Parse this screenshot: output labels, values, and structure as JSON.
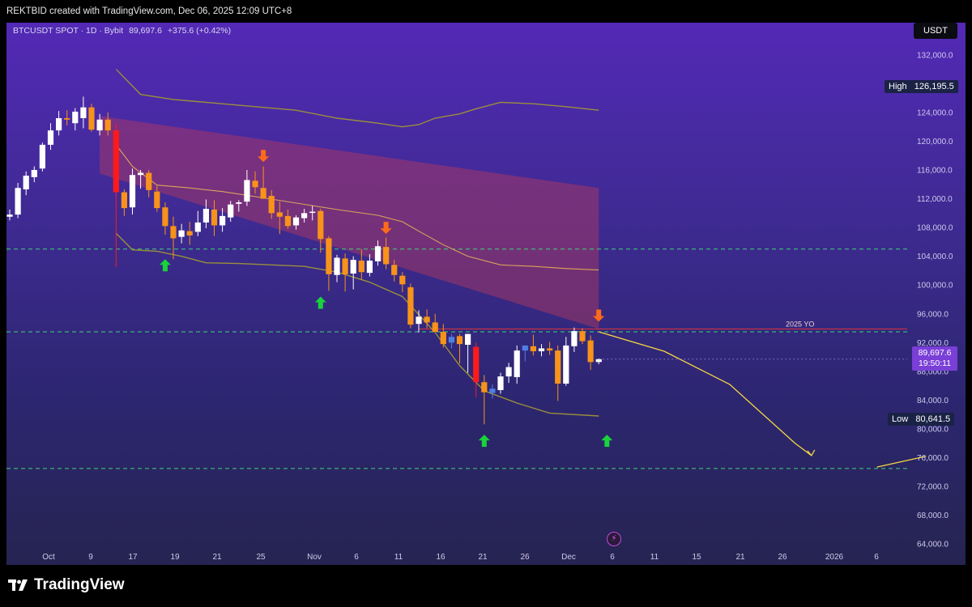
{
  "header": {
    "credit": "REKTBID created with TradingView.com, Dec 06, 2025 12:09 UTC+8"
  },
  "legend": {
    "symbol": "BTCUSDT SPOT · 1D · Bybit",
    "last": "89,697.6",
    "change": "+375.6 (+0.42%)"
  },
  "axis": {
    "currency": "USDT",
    "y_ticks": [
      "132,000.0",
      "128,000.0",
      "124,000.0",
      "120,000.0",
      "116,000.0",
      "112,000.0",
      "108,000.0",
      "104,000.0",
      "100,000.0",
      "96,000.0",
      "92,000.0",
      "88,000.0",
      "84,000.0",
      "80,000.0",
      "76,000.0",
      "72,000.0",
      "68,000.0",
      "64,000.0"
    ],
    "x_ticks": [
      "Oct",
      "9",
      "17",
      "19",
      "21",
      "25",
      "Nov",
      "6",
      "11",
      "16",
      "21",
      "26",
      "Dec",
      "6",
      "11",
      "15",
      "21",
      "26",
      "2026",
      "6"
    ]
  },
  "markers": {
    "high_label": "High",
    "high_value": "126,195.5",
    "low_label": "Low",
    "low_value": "80,641.5",
    "price_value": "89,697.6",
    "countdown": "19:50:11",
    "yo_label": "2025 YO"
  },
  "brand": {
    "name": "TradingView"
  },
  "colors": {
    "up": "#ffffff",
    "down": "#f7931a",
    "highlight_down": "#ff1a1a",
    "highlight_up": "#4f7fe0",
    "band": "#9a8f3a",
    "mid_band": "#d9a45a",
    "zone": "#b93a5e",
    "level": "#3fd47a",
    "yo_line": "#e0303a",
    "projection": "#f5d742",
    "arrow_up": "#19d33a",
    "arrow_down": "#ff6a1a"
  },
  "chart_data": {
    "type": "candlestick",
    "symbol": "BTCUSDT",
    "interval": "1D",
    "ylim": [
      62000,
      134000
    ],
    "horizontal_levels": [
      105000,
      93500,
      74500
    ],
    "yo_level": 93900,
    "candles": [
      {
        "o": 109500,
        "h": 110500,
        "l": 109000,
        "c": 109800
      },
      {
        "o": 109800,
        "h": 114200,
        "l": 109300,
        "c": 113500
      },
      {
        "o": 113300,
        "h": 115800,
        "l": 112500,
        "c": 115200
      },
      {
        "o": 115000,
        "h": 116500,
        "l": 114300,
        "c": 116000
      },
      {
        "o": 116200,
        "h": 119800,
        "l": 115800,
        "c": 119500
      },
      {
        "o": 119500,
        "h": 122500,
        "l": 118800,
        "c": 121500
      },
      {
        "o": 121500,
        "h": 124200,
        "l": 120800,
        "c": 123200
      },
      {
        "o": 123200,
        "h": 124300,
        "l": 122200,
        "c": 123000
      },
      {
        "o": 122500,
        "h": 124600,
        "l": 121500,
        "c": 124100
      },
      {
        "o": 123200,
        "h": 126195,
        "l": 121800,
        "c": 124700
      },
      {
        "o": 124700,
        "h": 125200,
        "l": 121300,
        "c": 121600
      },
      {
        "o": 121500,
        "h": 123800,
        "l": 120800,
        "c": 123000
      },
      {
        "o": 123000,
        "h": 124000,
        "l": 120800,
        "c": 121500
      },
      {
        "o": 121500,
        "h": 122500,
        "l": 102500,
        "c": 112900
      },
      {
        "o": 112900,
        "h": 113300,
        "l": 109600,
        "c": 110700
      },
      {
        "o": 110800,
        "h": 116200,
        "l": 109800,
        "c": 115300
      },
      {
        "o": 115300,
        "h": 116000,
        "l": 113400,
        "c": 115600
      },
      {
        "o": 115600,
        "h": 116000,
        "l": 112200,
        "c": 113200
      },
      {
        "o": 113000,
        "h": 113800,
        "l": 110200,
        "c": 110700
      },
      {
        "o": 110800,
        "h": 111500,
        "l": 107000,
        "c": 108200
      },
      {
        "o": 108200,
        "h": 109500,
        "l": 103600,
        "c": 106500
      },
      {
        "o": 106700,
        "h": 108500,
        "l": 105800,
        "c": 107600
      },
      {
        "o": 107500,
        "h": 108800,
        "l": 105600,
        "c": 106900
      },
      {
        "o": 107400,
        "h": 110300,
        "l": 106800,
        "c": 108700
      },
      {
        "o": 108700,
        "h": 111900,
        "l": 107900,
        "c": 110600
      },
      {
        "o": 110500,
        "h": 111800,
        "l": 106800,
        "c": 108300
      },
      {
        "o": 108300,
        "h": 110700,
        "l": 107400,
        "c": 109600
      },
      {
        "o": 109400,
        "h": 111700,
        "l": 108800,
        "c": 111200
      },
      {
        "o": 111300,
        "h": 111800,
        "l": 110200,
        "c": 111500
      },
      {
        "o": 111600,
        "h": 116000,
        "l": 111000,
        "c": 114600
      },
      {
        "o": 114500,
        "h": 115800,
        "l": 112700,
        "c": 113600
      },
      {
        "o": 113500,
        "h": 116500,
        "l": 112800,
        "c": 112000
      },
      {
        "o": 112400,
        "h": 113200,
        "l": 109200,
        "c": 110000
      },
      {
        "o": 110100,
        "h": 111600,
        "l": 107100,
        "c": 109500
      },
      {
        "o": 109600,
        "h": 110500,
        "l": 107800,
        "c": 108200
      },
      {
        "o": 108300,
        "h": 109700,
        "l": 107700,
        "c": 109400
      },
      {
        "o": 109300,
        "h": 110600,
        "l": 108700,
        "c": 110000
      },
      {
        "o": 110100,
        "h": 111000,
        "l": 109000,
        "c": 110200
      },
      {
        "o": 110300,
        "h": 110600,
        "l": 104500,
        "c": 106400
      },
      {
        "o": 106500,
        "h": 106800,
        "l": 99200,
        "c": 101500
      },
      {
        "o": 101400,
        "h": 104200,
        "l": 100400,
        "c": 103800
      },
      {
        "o": 103700,
        "h": 104400,
        "l": 99100,
        "c": 101500
      },
      {
        "o": 101600,
        "h": 104000,
        "l": 99400,
        "c": 103500
      },
      {
        "o": 103400,
        "h": 105000,
        "l": 100800,
        "c": 101800
      },
      {
        "o": 101700,
        "h": 104300,
        "l": 101200,
        "c": 103400
      },
      {
        "o": 103300,
        "h": 106200,
        "l": 102700,
        "c": 105400
      },
      {
        "o": 105300,
        "h": 106600,
        "l": 102200,
        "c": 102900
      },
      {
        "o": 102800,
        "h": 103500,
        "l": 100500,
        "c": 101400
      },
      {
        "o": 101300,
        "h": 101800,
        "l": 99000,
        "c": 100100
      },
      {
        "o": 99700,
        "h": 100200,
        "l": 94000,
        "c": 94500
      },
      {
        "o": 94600,
        "h": 96500,
        "l": 93400,
        "c": 95600
      },
      {
        "o": 95600,
        "h": 96600,
        "l": 94000,
        "c": 94800
      },
      {
        "o": 94800,
        "h": 96000,
        "l": 93800,
        "c": 93500
      },
      {
        "o": 93500,
        "h": 94600,
        "l": 91300,
        "c": 91800
      },
      {
        "o": 92000,
        "h": 93200,
        "l": 91200,
        "c": 92800
      },
      {
        "o": 92900,
        "h": 93200,
        "l": 89100,
        "c": 91800
      },
      {
        "o": 91700,
        "h": 93200,
        "l": 87800,
        "c": 93200
      },
      {
        "o": 91400,
        "h": 92000,
        "l": 84400,
        "c": 86500
      },
      {
        "o": 86500,
        "h": 87500,
        "l": 80641,
        "c": 85100
      },
      {
        "o": 85000,
        "h": 86200,
        "l": 84200,
        "c": 85600
      },
      {
        "o": 85400,
        "h": 87800,
        "l": 84900,
        "c": 87300
      },
      {
        "o": 87300,
        "h": 89200,
        "l": 86400,
        "c": 88600
      },
      {
        "o": 87200,
        "h": 91600,
        "l": 86300,
        "c": 90900
      },
      {
        "o": 90900,
        "h": 91500,
        "l": 89400,
        "c": 91600
      },
      {
        "o": 91500,
        "h": 93100,
        "l": 90200,
        "c": 90800
      },
      {
        "o": 90800,
        "h": 91800,
        "l": 90100,
        "c": 91200
      },
      {
        "o": 91200,
        "h": 92100,
        "l": 90300,
        "c": 90900
      },
      {
        "o": 90900,
        "h": 91600,
        "l": 83900,
        "c": 86300
      },
      {
        "o": 86300,
        "h": 92800,
        "l": 86000,
        "c": 91600
      },
      {
        "o": 91500,
        "h": 94100,
        "l": 90700,
        "c": 93600
      },
      {
        "o": 93600,
        "h": 94000,
        "l": 91800,
        "c": 92200
      },
      {
        "o": 92300,
        "h": 93000,
        "l": 88200,
        "c": 89300
      },
      {
        "o": 89300,
        "h": 89800,
        "l": 89000,
        "c": 89700
      }
    ],
    "candle_overrides": {
      "13": "highlight_down",
      "57": "highlight_down",
      "54": "highlight_up",
      "59": "highlight_up",
      "63": "highlight_up"
    },
    "upper_band": [
      [
        13,
        130000
      ],
      [
        16,
        126500
      ],
      [
        20,
        125800
      ],
      [
        25,
        125300
      ],
      [
        30,
        124800
      ],
      [
        35,
        124300
      ],
      [
        40,
        123200
      ],
      [
        45,
        122500
      ],
      [
        48,
        122000
      ],
      [
        50,
        122300
      ],
      [
        52,
        123200
      ],
      [
        55,
        123800
      ],
      [
        57,
        124500
      ],
      [
        60,
        125400
      ],
      [
        64,
        125200
      ],
      [
        68,
        124800
      ],
      [
        72,
        124300
      ]
    ],
    "middle_band": [
      [
        13,
        119500
      ],
      [
        15,
        116500
      ],
      [
        18,
        113900
      ],
      [
        22,
        113500
      ],
      [
        26,
        113000
      ],
      [
        30,
        112300
      ],
      [
        35,
        111400
      ],
      [
        40,
        110500
      ],
      [
        45,
        109700
      ],
      [
        48,
        108800
      ],
      [
        50,
        107500
      ],
      [
        53,
        105600
      ],
      [
        56,
        104000
      ],
      [
        60,
        102800
      ],
      [
        64,
        102600
      ],
      [
        68,
        102300
      ],
      [
        72,
        102100
      ]
    ],
    "lower_band": [
      [
        13,
        107200
      ],
      [
        15,
        104900
      ],
      [
        18,
        104700
      ],
      [
        21,
        104000
      ],
      [
        24,
        103100
      ],
      [
        28,
        103000
      ],
      [
        32,
        102800
      ],
      [
        36,
        102600
      ],
      [
        40,
        101800
      ],
      [
        44,
        100400
      ],
      [
        48,
        98400
      ],
      [
        52,
        93400
      ],
      [
        55,
        88800
      ],
      [
        58,
        85300
      ],
      [
        62,
        83600
      ],
      [
        66,
        82200
      ],
      [
        72,
        81800
      ]
    ],
    "zone": {
      "from_index": 11,
      "to_index": 72,
      "top_start": 123500,
      "top_end": 113500,
      "bottom_start": 115500,
      "bottom_end": 93900
    },
    "projection": [
      [
        72,
        93500
      ],
      [
        80,
        90800
      ],
      [
        88,
        86200
      ],
      [
        96,
        78000
      ],
      [
        98,
        76300
      ]
    ],
    "projection_2": [
      [
        106,
        74700
      ],
      [
        112,
        76200
      ]
    ],
    "arrows_down": [
      [
        31,
        118000
      ],
      [
        46,
        108000
      ],
      [
        72,
        95800
      ]
    ],
    "arrows_up": [
      [
        19,
        102700
      ],
      [
        38,
        97500
      ],
      [
        58,
        78300
      ],
      [
        73,
        78300
      ]
    ]
  }
}
